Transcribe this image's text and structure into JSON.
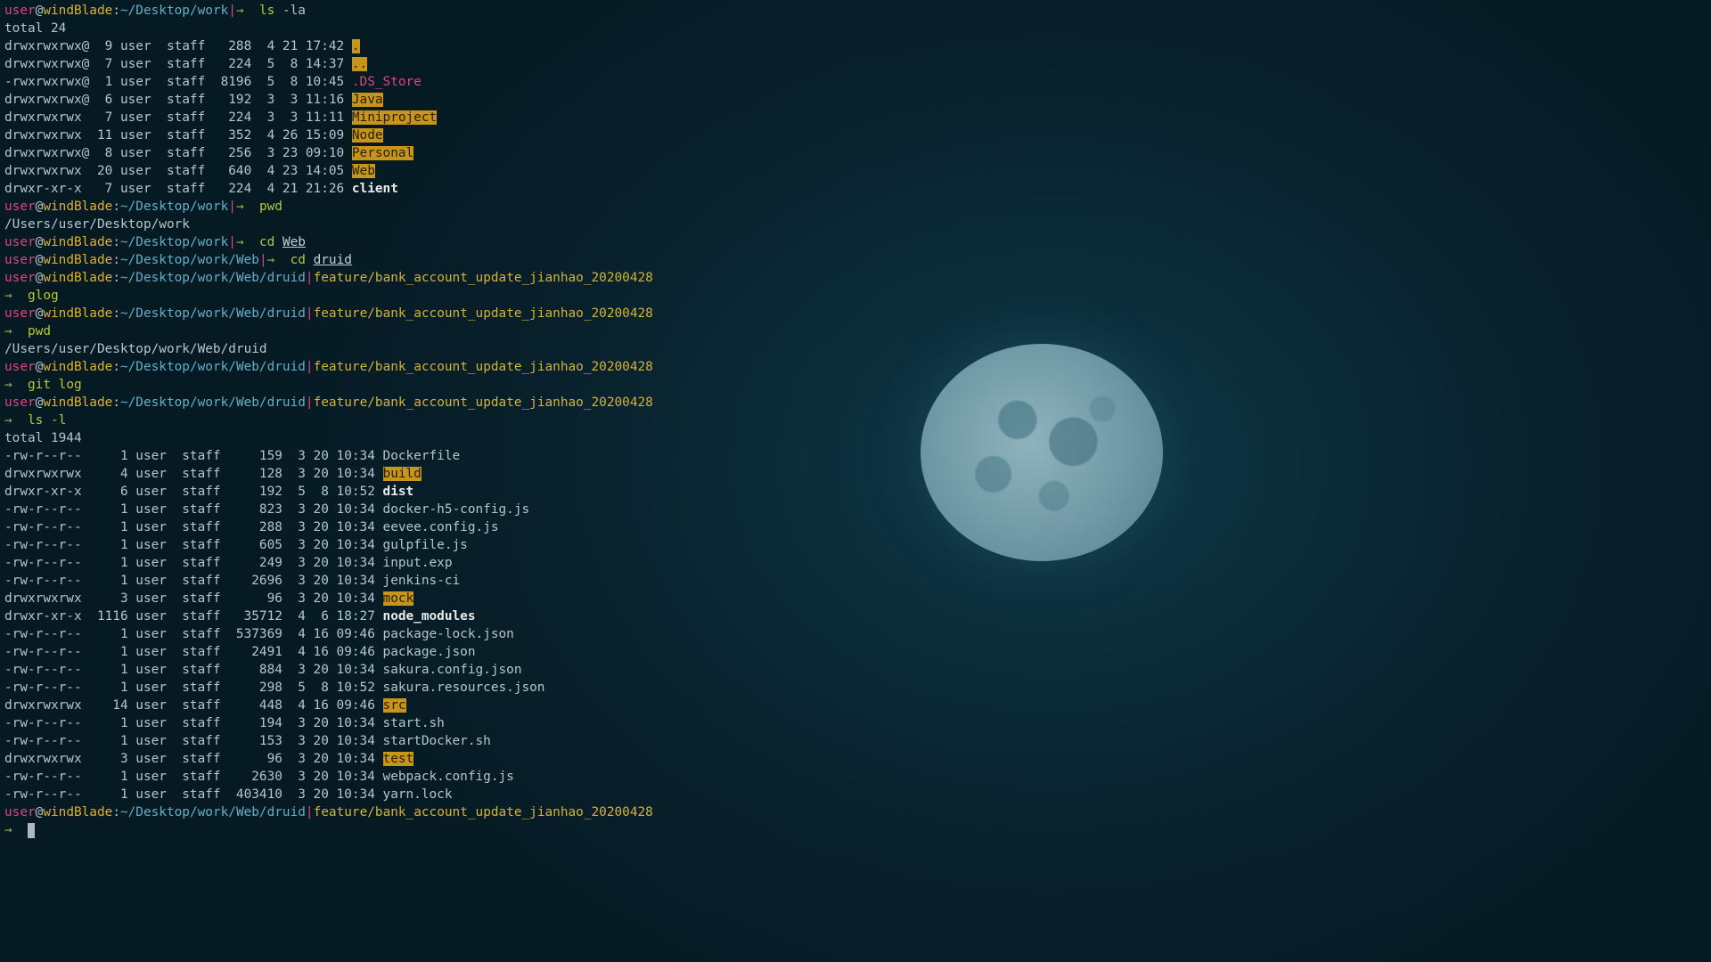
{
  "prompt": {
    "user": "user",
    "at": "@",
    "host": "windBlade",
    "colon": ":",
    "pipe": "|",
    "arrow": "→"
  },
  "lines": [
    {
      "kind": "prompt",
      "path": "~/Desktop/work",
      "branch": "",
      "cmd": "ls",
      "args": "-la",
      "inline": true
    },
    {
      "kind": "text",
      "text": "total 24"
    },
    {
      "kind": "entry",
      "meta": "drwxrwxrwx@  9 user  staff   288  4 21 17:42 ",
      "name": ".",
      "style": "hl"
    },
    {
      "kind": "entry",
      "meta": "drwxrwxrwx@  7 user  staff   224  5  8 14:37 ",
      "name": "..",
      "style": "hl"
    },
    {
      "kind": "entry",
      "meta": "-rwxrwxrwx@  1 user  staff  8196  5  8 10:45 ",
      "name": ".DS_Store",
      "style": "ds"
    },
    {
      "kind": "entry",
      "meta": "drwxrwxrwx@  6 user  staff   192  3  3 11:16 ",
      "name": "Java",
      "style": "hl"
    },
    {
      "kind": "entry",
      "meta": "drwxrwxrwx   7 user  staff   224  3  3 11:11 ",
      "name": "Miniproject",
      "style": "hl"
    },
    {
      "kind": "entry",
      "meta": "drwxrwxrwx  11 user  staff   352  4 26 15:09 ",
      "name": "Node",
      "style": "hl"
    },
    {
      "kind": "entry",
      "meta": "drwxrwxrwx@  8 user  staff   256  3 23 09:10 ",
      "name": "Personal",
      "style": "hl"
    },
    {
      "kind": "entry",
      "meta": "drwxrwxrwx  20 user  staff   640  4 23 14:05 ",
      "name": "Web",
      "style": "hl"
    },
    {
      "kind": "entry",
      "meta": "drwxr-xr-x   7 user  staff   224  4 21 21:26 ",
      "name": "client",
      "style": "bold"
    },
    {
      "kind": "prompt",
      "path": "~/Desktop/work",
      "branch": "",
      "cmd": "pwd",
      "args": "",
      "inline": true
    },
    {
      "kind": "text",
      "text": "/Users/user/Desktop/work"
    },
    {
      "kind": "prompt",
      "path": "~/Desktop/work",
      "branch": "",
      "cmd": "cd",
      "args": "Web",
      "inline": true
    },
    {
      "kind": "prompt",
      "path": "~/Desktop/work/Web",
      "branch": "",
      "cmd": "cd",
      "args": "druid",
      "inline": true
    },
    {
      "kind": "prompt",
      "path": "~/Desktop/work/Web/druid",
      "branch": "feature/bank_account_update_jianhao_20200428",
      "cmd": "",
      "args": "",
      "inline": false
    },
    {
      "kind": "command",
      "cmd": "glog",
      "args": ""
    },
    {
      "kind": "prompt",
      "path": "~/Desktop/work/Web/druid",
      "branch": "feature/bank_account_update_jianhao_20200428",
      "cmd": "",
      "args": "",
      "inline": false
    },
    {
      "kind": "command",
      "cmd": "pwd",
      "args": ""
    },
    {
      "kind": "text",
      "text": "/Users/user/Desktop/work/Web/druid"
    },
    {
      "kind": "prompt",
      "path": "~/Desktop/work/Web/druid",
      "branch": "feature/bank_account_update_jianhao_20200428",
      "cmd": "",
      "args": "",
      "inline": false
    },
    {
      "kind": "command",
      "cmd": "git log",
      "args": ""
    },
    {
      "kind": "prompt",
      "path": "~/Desktop/work/Web/druid",
      "branch": "feature/bank_account_update_jianhao_20200428",
      "cmd": "",
      "args": "",
      "inline": false
    },
    {
      "kind": "command",
      "cmd": "ls -l",
      "args": ""
    },
    {
      "kind": "text",
      "text": "total 1944"
    },
    {
      "kind": "entry",
      "meta": "-rw-r--r--     1 user  staff     159  3 20 10:34 ",
      "name": "Dockerfile",
      "style": "plain"
    },
    {
      "kind": "entry",
      "meta": "drwxrwxrwx     4 user  staff     128  3 20 10:34 ",
      "name": "build",
      "style": "hl"
    },
    {
      "kind": "entry",
      "meta": "drwxr-xr-x     6 user  staff     192  5  8 10:52 ",
      "name": "dist",
      "style": "bold"
    },
    {
      "kind": "entry",
      "meta": "-rw-r--r--     1 user  staff     823  3 20 10:34 ",
      "name": "docker-h5-config.js",
      "style": "plain"
    },
    {
      "kind": "entry",
      "meta": "-rw-r--r--     1 user  staff     288  3 20 10:34 ",
      "name": "eevee.config.js",
      "style": "plain"
    },
    {
      "kind": "entry",
      "meta": "-rw-r--r--     1 user  staff     605  3 20 10:34 ",
      "name": "gulpfile.js",
      "style": "plain"
    },
    {
      "kind": "entry",
      "meta": "-rw-r--r--     1 user  staff     249  3 20 10:34 ",
      "name": "input.exp",
      "style": "plain"
    },
    {
      "kind": "entry",
      "meta": "-rw-r--r--     1 user  staff    2696  3 20 10:34 ",
      "name": "jenkins-ci",
      "style": "plain"
    },
    {
      "kind": "entry",
      "meta": "drwxrwxrwx     3 user  staff      96  3 20 10:34 ",
      "name": "mock",
      "style": "hl"
    },
    {
      "kind": "entry",
      "meta": "drwxr-xr-x  1116 user  staff   35712  4  6 18:27 ",
      "name": "node_modules",
      "style": "bold"
    },
    {
      "kind": "entry",
      "meta": "-rw-r--r--     1 user  staff  537369  4 16 09:46 ",
      "name": "package-lock.json",
      "style": "plain"
    },
    {
      "kind": "entry",
      "meta": "-rw-r--r--     1 user  staff    2491  4 16 09:46 ",
      "name": "package.json",
      "style": "plain"
    },
    {
      "kind": "entry",
      "meta": "-rw-r--r--     1 user  staff     884  3 20 10:34 ",
      "name": "sakura.config.json",
      "style": "plain"
    },
    {
      "kind": "entry",
      "meta": "-rw-r--r--     1 user  staff     298  5  8 10:52 ",
      "name": "sakura.resources.json",
      "style": "plain"
    },
    {
      "kind": "entry",
      "meta": "drwxrwxrwx    14 user  staff     448  4 16 09:46 ",
      "name": "src",
      "style": "hl"
    },
    {
      "kind": "entry",
      "meta": "-rw-r--r--     1 user  staff     194  3 20 10:34 ",
      "name": "start.sh",
      "style": "plain"
    },
    {
      "kind": "entry",
      "meta": "-rw-r--r--     1 user  staff     153  3 20 10:34 ",
      "name": "startDocker.sh",
      "style": "plain"
    },
    {
      "kind": "entry",
      "meta": "drwxrwxrwx     3 user  staff      96  3 20 10:34 ",
      "name": "test",
      "style": "hl"
    },
    {
      "kind": "entry",
      "meta": "-rw-r--r--     1 user  staff    2630  3 20 10:34 ",
      "name": "webpack.config.js",
      "style": "plain"
    },
    {
      "kind": "entry",
      "meta": "-rw-r--r--     1 user  staff  403410  3 20 10:34 ",
      "name": "yarn.lock",
      "style": "plain"
    },
    {
      "kind": "prompt",
      "path": "~/Desktop/work/Web/druid",
      "branch": "feature/bank_account_update_jianhao_20200428",
      "cmd": "",
      "args": "",
      "inline": false
    },
    {
      "kind": "cursor"
    }
  ],
  "colors": {
    "user": "#e0457b",
    "host": "#e0b22b",
    "path": "#5fb0c8",
    "branch": "#d4b23a",
    "command": "#b5c93a",
    "dir_highlight": "#c8951b",
    "background": "#08202b"
  }
}
